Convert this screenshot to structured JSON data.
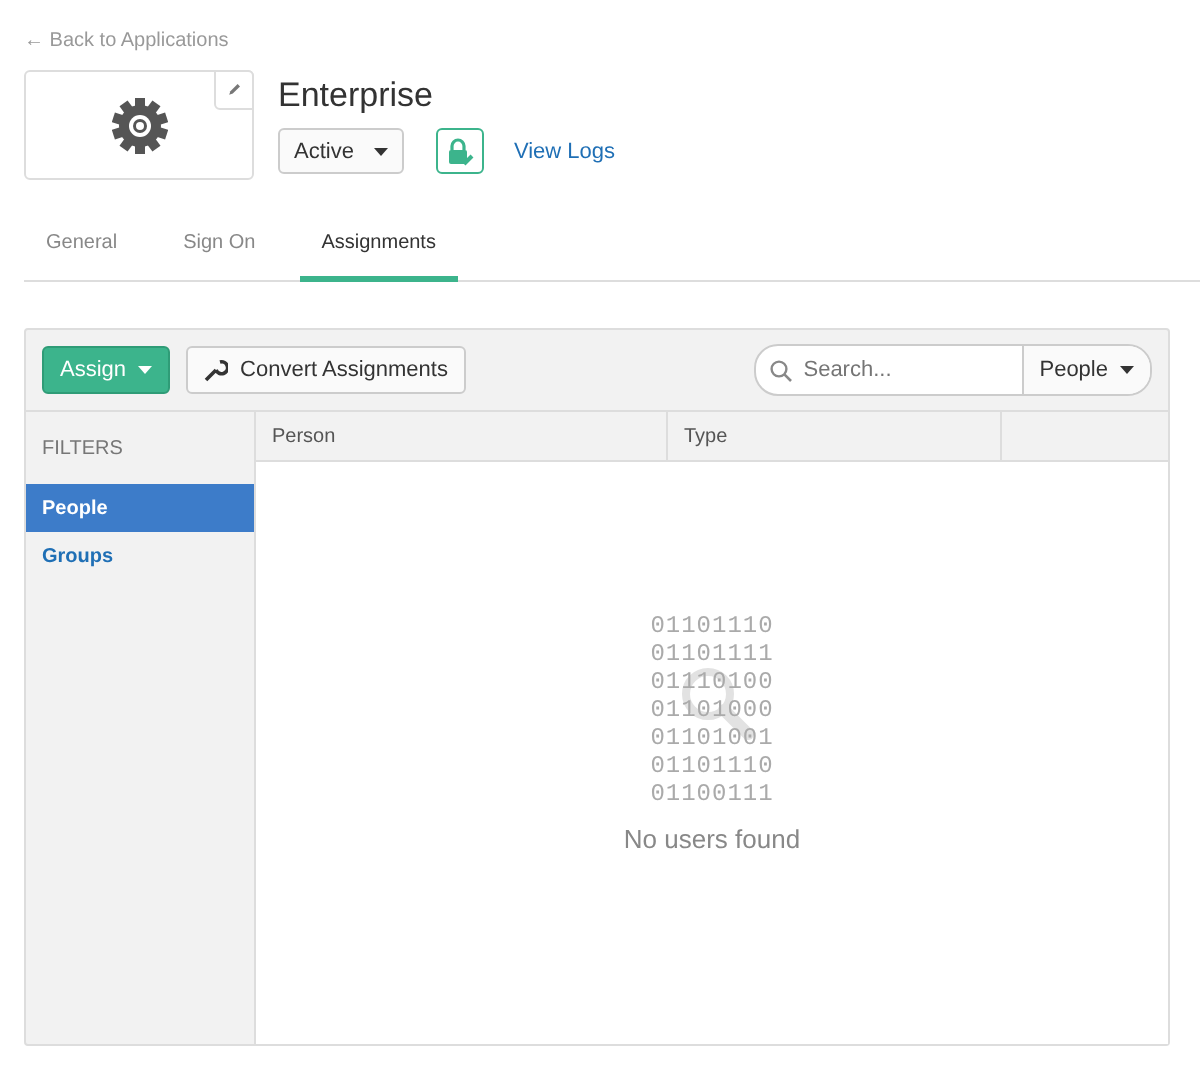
{
  "back_link": "← Back to Applications",
  "app": {
    "title": "Enterprise",
    "status": "Active"
  },
  "view_logs": "View Logs",
  "tabs": [
    {
      "label": "General",
      "selected": false
    },
    {
      "label": "Sign On",
      "selected": false
    },
    {
      "label": "Assignments",
      "selected": true
    }
  ],
  "toolbar": {
    "assign": "Assign",
    "convert": "Convert Assignments",
    "search": {
      "placeholder": "Search..."
    },
    "scope": "People"
  },
  "filters": {
    "heading": "FILTERS",
    "items": [
      {
        "label": "People",
        "selected": true
      },
      {
        "label": "Groups",
        "selected": false
      }
    ]
  },
  "table": {
    "columns": [
      "Person",
      "Type"
    ]
  },
  "empty_state": {
    "binary": [
      "01101110",
      "01101111",
      "01110100",
      "01101000",
      "01101001",
      "01101110",
      "01100111"
    ],
    "message": "No users found"
  }
}
